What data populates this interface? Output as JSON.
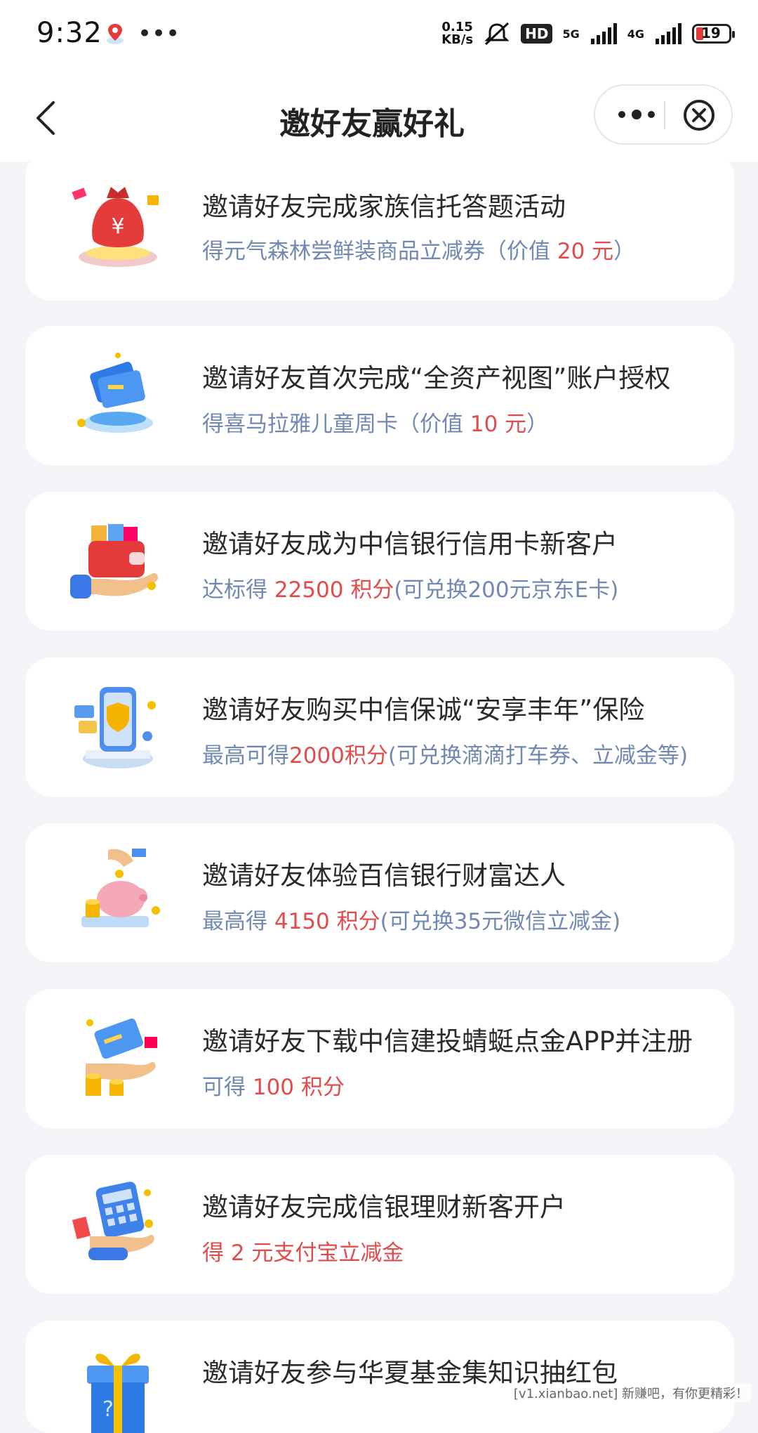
{
  "status": {
    "time": "9:32",
    "speed_value": "0.15",
    "speed_unit": "KB/s",
    "hd": "HD",
    "net1": "5G",
    "net2": "4G",
    "battery": "19"
  },
  "nav": {
    "title": "邀好友赢好礼"
  },
  "cards": [
    {
      "title": "邀请好友完成家族信托答题活动",
      "sub_pre": "得元气森林尝鲜装商品立减券（价值 ",
      "sub_hl": "20 元",
      "sub_post": "）"
    },
    {
      "title": "邀请好友首次完成“全资产视图”账户授权",
      "sub_pre": "得喜马拉雅儿童周卡（价值 ",
      "sub_hl": "10 元",
      "sub_post": "）"
    },
    {
      "title": "邀请好友成为中信银行信用卡新客户",
      "sub_pre": "达标得 ",
      "sub_hl": "22500 积分",
      "sub_post": "(可兑换200元京东E卡)"
    },
    {
      "title": "邀请好友购买中信保诚“安享丰年”保险",
      "sub_pre": "最高可得",
      "sub_hl": "2000积分",
      "sub_post": "(可兑换滴滴打车券、立减金等)"
    },
    {
      "title": "邀请好友体验百信银行财富达人",
      "sub_pre": "最高得 ",
      "sub_hl": "4150 积分",
      "sub_post": "(可兑换35元微信立减金)"
    },
    {
      "title": "邀请好友下载中信建投蜻蜓点金APP并注册",
      "sub_pre": "可得 ",
      "sub_hl": "100 积分",
      "sub_post": ""
    },
    {
      "title": "邀请好友完成信银理财新客开户",
      "sub_pre": "得 ",
      "sub_hl": "2 元支付宝立减金",
      "sub_post": ""
    },
    {
      "title": "邀请好友参与华夏基金集知识抽红包",
      "sub_pre": "",
      "sub_hl": "",
      "sub_post": ""
    }
  ],
  "watermark": "[v1.xianbao.net] 新赚吧，有你更精彩！"
}
